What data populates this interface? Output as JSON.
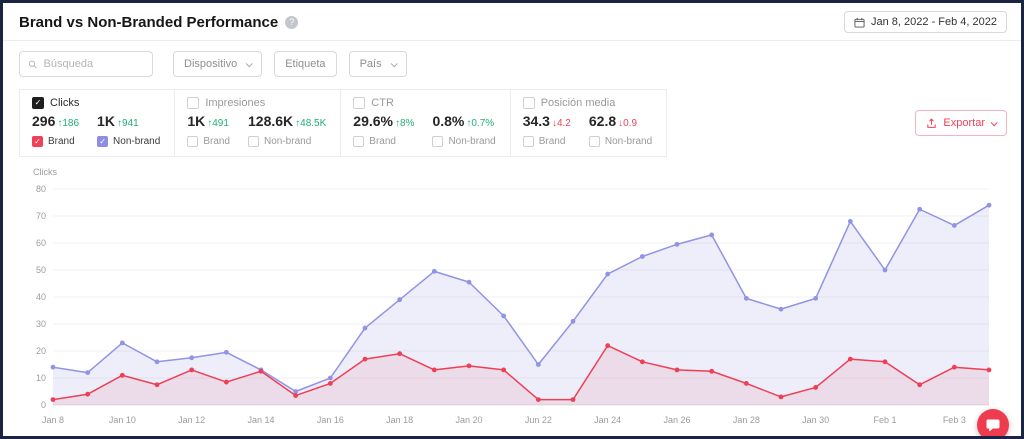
{
  "header": {
    "title": "Brand vs Non-Branded Performance",
    "help_icon": "?",
    "date_range": "Jan 8, 2022 - Feb 4, 2022"
  },
  "filters": {
    "search_placeholder": "Búsqueda",
    "device_label": "Dispositivo",
    "tag_label": "Etiqueta",
    "country_label": "País"
  },
  "export": {
    "label": "Exportar"
  },
  "metrics": {
    "cards": [
      {
        "label": "Clicks",
        "values": [
          {
            "value": "296",
            "arrow": "↑",
            "delta": "186"
          },
          {
            "value": "1K",
            "arrow": "↑",
            "delta": "941"
          }
        ],
        "sub": [
          {
            "label": "Brand"
          },
          {
            "label": "Non-brand"
          }
        ]
      },
      {
        "label": "Impresiones",
        "values": [
          {
            "value": "1K",
            "arrow": "↑",
            "delta": "491"
          },
          {
            "value": "128.6K",
            "arrow": "↑",
            "delta": "48.5K"
          }
        ],
        "sub": [
          {
            "label": "Brand"
          },
          {
            "label": "Non-brand"
          }
        ]
      },
      {
        "label": "CTR",
        "values": [
          {
            "value": "29.6%",
            "arrow": "↑",
            "delta": "8%"
          },
          {
            "value": "0.8%",
            "arrow": "↑",
            "delta": "0.7%"
          }
        ],
        "sub": [
          {
            "label": "Brand"
          },
          {
            "label": "Non-brand"
          }
        ]
      },
      {
        "label": "Posición media",
        "values": [
          {
            "value": "34.3",
            "arrow": "↓",
            "delta": "4.2"
          },
          {
            "value": "62.8",
            "arrow": "↓",
            "delta": "0.9"
          }
        ],
        "sub": [
          {
            "label": "Brand"
          },
          {
            "label": "Non-brand"
          }
        ]
      }
    ]
  },
  "chart_data": {
    "type": "line",
    "title": "",
    "xlabel": "",
    "ylabel": "Clicks",
    "ylim": [
      0,
      80
    ],
    "grid": true,
    "legend_position": "none",
    "y_ticks": [
      0,
      10,
      20,
      30,
      40,
      50,
      60,
      70,
      80
    ],
    "categories": [
      "Jan 8",
      "Jan 9",
      "Jan 10",
      "Jan 11",
      "Jan 12",
      "Jan 13",
      "Jan 14",
      "Jan 15",
      "Jan 16",
      "Jan 17",
      "Jan 18",
      "Jan 19",
      "Jan 20",
      "Jan 21",
      "Jan 22",
      "Jan 23",
      "Jan 24",
      "Jan 25",
      "Jan 26",
      "Jan 27",
      "Jan 28",
      "Jan 29",
      "Jan 30",
      "Jan 31",
      "Feb 1",
      "Feb 2",
      "Feb 3",
      "Feb 4"
    ],
    "tick_labels": [
      "Jan 8",
      "Jan 10",
      "Jan 12",
      "Jan 14",
      "Jan 16",
      "Jan 18",
      "Jan 20",
      "Jun 22",
      "Jan 24",
      "Jan 26",
      "Jan 28",
      "Jan 30",
      "Feb 1",
      "Feb 3"
    ],
    "tick_indices": [
      0,
      2,
      4,
      6,
      8,
      10,
      12,
      14,
      16,
      18,
      20,
      22,
      24,
      26
    ],
    "series": [
      {
        "name": "Non-brand",
        "color": "#9193e3",
        "fill": "rgba(145,147,227,0.16)",
        "values": [
          14,
          12,
          23,
          16,
          17.5,
          19.5,
          13,
          5,
          10,
          28.5,
          39,
          49.5,
          45.5,
          33,
          15,
          31,
          48.5,
          55,
          59.5,
          63,
          39.5,
          35.5,
          39.5,
          68,
          50,
          72.5,
          66.5,
          74
        ]
      },
      {
        "name": "Brand",
        "color": "#ee3f55",
        "fill": "rgba(238,63,85,0.10)",
        "values": [
          2,
          4,
          11,
          7.5,
          13,
          8.5,
          12.5,
          3.5,
          8,
          17,
          19,
          13,
          14.5,
          13,
          2,
          2,
          22,
          16,
          13,
          12.5,
          8,
          3,
          6.5,
          17,
          16,
          7.5,
          14,
          13
        ]
      }
    ]
  }
}
